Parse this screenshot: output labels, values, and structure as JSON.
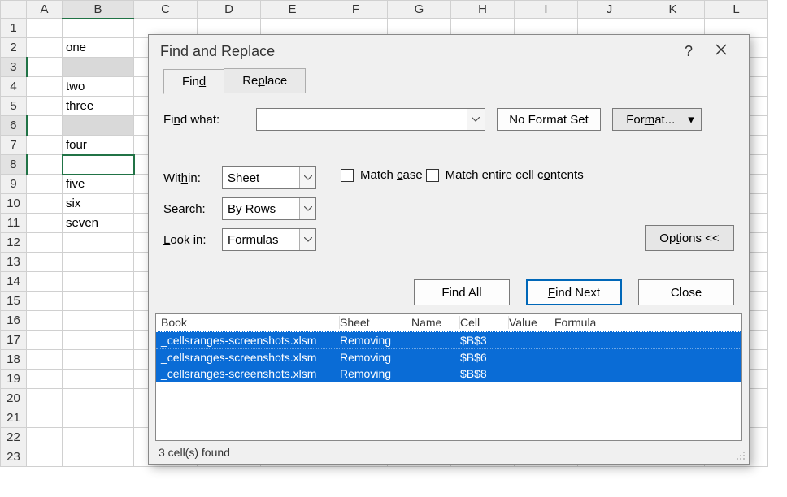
{
  "sheet": {
    "columns": [
      "A",
      "B",
      "C",
      "D",
      "E",
      "F",
      "G",
      "H",
      "I",
      "J",
      "K",
      "L"
    ],
    "rows": 23,
    "data": {
      "B2": "one",
      "B4": "two",
      "B5": "three",
      "B7": "four",
      "B9": "five",
      "B10": "six",
      "B11": "seven"
    },
    "highlighted": [
      "B3",
      "B6"
    ],
    "active": "B8",
    "selected_col": "B",
    "selected_rows": [
      3,
      6,
      8
    ]
  },
  "dialog": {
    "title": "Find and Replace",
    "tabs": {
      "find": "Find",
      "replace": "Replace"
    },
    "active_tab": "find",
    "find_what_label": "Find what:",
    "find_what_value": "",
    "no_format": "No Format Set",
    "format_btn": "Format...",
    "within_label": "Within:",
    "within_value": "Sheet",
    "search_label": "Search:",
    "search_value": "By Rows",
    "lookin_label": "Look in:",
    "lookin_value": "Formulas",
    "match_case": "Match case",
    "match_entire": "Match entire cell contents",
    "options_btn": "Options <<",
    "find_all": "Find All",
    "find_next": "Find Next",
    "close": "Close",
    "results": {
      "headers": [
        "Book",
        "Sheet",
        "Name",
        "Cell",
        "Value",
        "Formula"
      ],
      "rows": [
        {
          "book": "_cellsranges-screenshots.xlsm",
          "sheet": "Removing",
          "name": "",
          "cell": "$B$3",
          "value": "",
          "formula": ""
        },
        {
          "book": "_cellsranges-screenshots.xlsm",
          "sheet": "Removing",
          "name": "",
          "cell": "$B$6",
          "value": "",
          "formula": ""
        },
        {
          "book": "_cellsranges-screenshots.xlsm",
          "sheet": "Removing",
          "name": "",
          "cell": "$B$8",
          "value": "",
          "formula": ""
        }
      ]
    },
    "status": "3 cell(s) found"
  }
}
